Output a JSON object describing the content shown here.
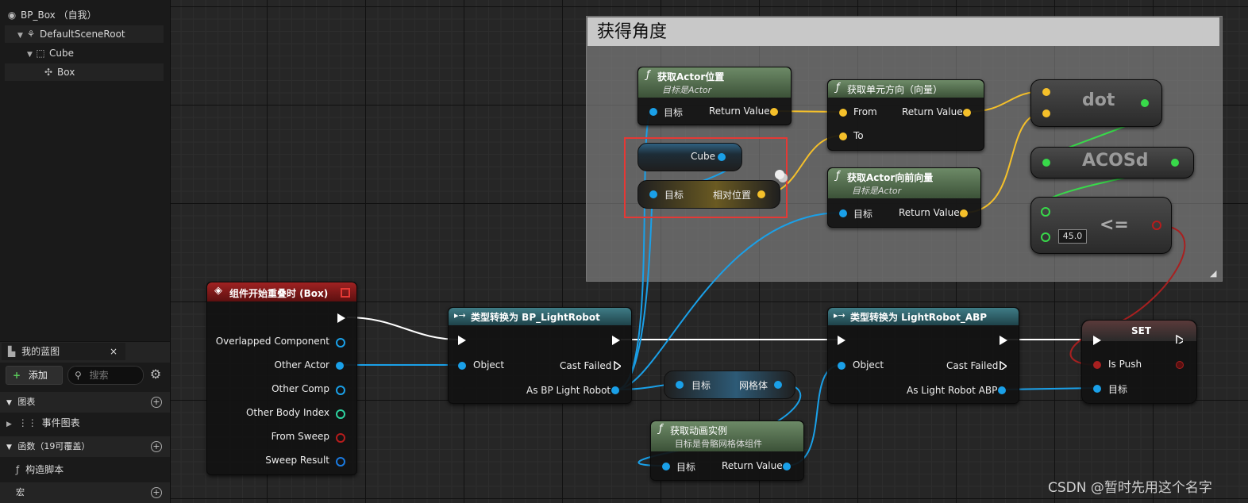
{
  "tree": {
    "root": "BP_Box （自我）",
    "items": [
      "DefaultSceneRoot",
      "Cube",
      "Box"
    ]
  },
  "my_blueprint": {
    "tab": "我的蓝图",
    "tab_close": "×",
    "add_label": "添加",
    "search_placeholder": "搜索",
    "sections": {
      "graphs": "图表",
      "event_graph": "事件图表",
      "functions": "函数（19可覆盖）",
      "construction": "构造脚本",
      "macros": "宏"
    }
  },
  "comment": {
    "title": "获得角度"
  },
  "nodes": {
    "get_actor_location": {
      "title": "获取Actor位置",
      "subtitle": "目标是Actor",
      "in_target": "目标",
      "out": "Return Value"
    },
    "get_unit_direction": {
      "title": "获取单元方向（向量）",
      "in_from": "From",
      "in_to": "To",
      "out": "Return Value"
    },
    "cube_var": {
      "label": "Cube"
    },
    "relative_location": {
      "in_target": "目标",
      "out": "相对位置"
    },
    "get_forward_vector": {
      "title": "获取Actor向前向量",
      "subtitle": "目标是Actor",
      "in_target": "目标",
      "out": "Return Value"
    },
    "dot": {
      "label": "dot"
    },
    "acosd": {
      "label": "ACOSd"
    },
    "lte": {
      "label": "<=",
      "value": "45.0"
    },
    "begin_overlap": {
      "title": "组件开始重叠时 (Box)",
      "outputs": [
        "Overlapped Component",
        "Other Actor",
        "Other Comp",
        "Other Body Index",
        "From Sweep",
        "Sweep Result"
      ]
    },
    "cast_robot": {
      "title": "类型转换为 BP_LightRobot",
      "in_object": "Object",
      "cast_failed": "Cast Failed",
      "out": "As BP Light Robot"
    },
    "mesh": {
      "in_target": "目标",
      "out": "网格体"
    },
    "get_anim_instance": {
      "title": "获取动画实例",
      "subtitle": "目标是骨骼网格体组件",
      "in_target": "目标",
      "out": "Return Value"
    },
    "cast_abp": {
      "title": "类型转换为 LightRobot_ABP",
      "in_object": "Object",
      "cast_failed": "Cast Failed",
      "out": "As Light Robot ABP"
    },
    "set": {
      "title": "SET",
      "is_push": "Is Push",
      "target": "目标"
    }
  },
  "colors": {
    "exec": "#ffffff",
    "object": "#1aa0e8",
    "vector": "#f5c02a",
    "float": "#38d94a",
    "bool": "#b71c1c",
    "struct": "#1a7ae0",
    "int": "#2ed3a0",
    "highlight": "#e53935"
  },
  "watermark": "CSDN @暂时先用这个名字"
}
